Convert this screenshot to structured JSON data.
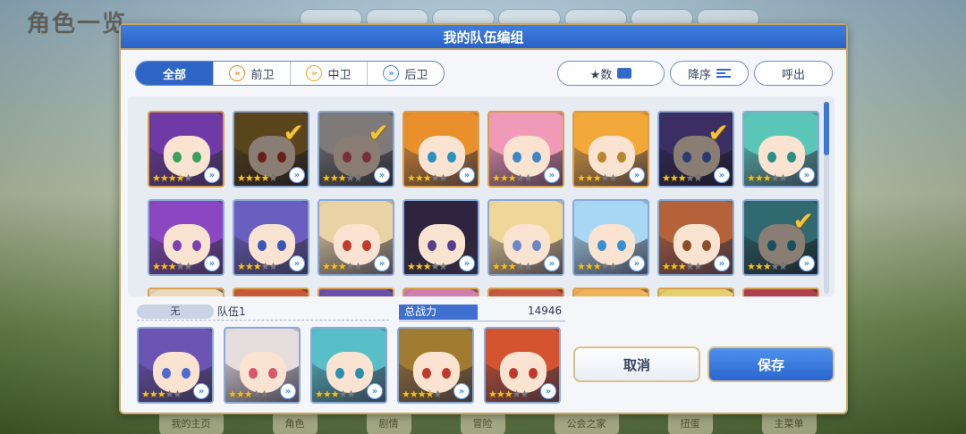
{
  "background": {
    "title": "角色一览",
    "bottom_nav": [
      "我的主页",
      "角色",
      "剧情",
      "冒险",
      "公会之家",
      "扭蛋",
      "主菜单"
    ]
  },
  "dialog": {
    "title": "我的队伍编组",
    "filters": [
      {
        "label": "全部",
        "icon": ""
      },
      {
        "label": "前卫",
        "icon": "front-role-icon"
      },
      {
        "label": "中卫",
        "icon": "middle-role-icon"
      },
      {
        "label": "后卫",
        "icon": "back-role-icon"
      }
    ],
    "star_button": "★数",
    "sort_button": "降序",
    "call_button": "呼出",
    "team": {
      "badge": "无",
      "name": "队伍1",
      "power_label": "总战力",
      "power_value": "14946"
    },
    "cancel_button": "取消",
    "save_button": "保存"
  },
  "colors": {
    "accent_blue": "#2f66c6",
    "gold_border": "#c9a662",
    "check": "#f2c43a"
  },
  "roster": [
    {
      "hair": "#6f3aa6",
      "eye": "#3aa05a",
      "stars": 4,
      "selected": false,
      "border": "gold"
    },
    {
      "hair": "#a27b32",
      "eye": "#c0392b",
      "stars": 4,
      "selected": true,
      "border": "blue"
    },
    {
      "hair": "#e6dede",
      "eye": "#d9556a",
      "stars": 3,
      "selected": true,
      "border": "blue"
    },
    {
      "hair": "#e98f2b",
      "eye": "#2c8fbf",
      "stars": 3,
      "selected": false,
      "border": "gold"
    },
    {
      "hair": "#f19ab8",
      "eye": "#3d86c7",
      "stars": 3,
      "selected": false,
      "border": "gold"
    },
    {
      "hair": "#f3a93a",
      "eye": "#b8862b",
      "stars": 3,
      "selected": false,
      "border": "gold"
    },
    {
      "hair": "#6c54b3",
      "eye": "#4f6bd0",
      "stars": 3,
      "selected": true,
      "border": "blue"
    },
    {
      "hair": "#5ac6b8",
      "eye": "#2a8f85",
      "stars": 3,
      "selected": false,
      "border": "blue"
    },
    {
      "hair": "#8a47c1",
      "eye": "#7b3fb0",
      "stars": 3,
      "selected": false,
      "border": "blue"
    },
    {
      "hair": "#6a5fc0",
      "eye": "#3a57b8",
      "stars": 3,
      "selected": false,
      "border": "blue"
    },
    {
      "hair": "#e9d3a4",
      "eye": "#c0392b",
      "stars": 3,
      "selected": false,
      "border": "blue"
    },
    {
      "hair": "#2f2440",
      "eye": "#5a3d8a",
      "stars": 3,
      "selected": false,
      "border": "blue"
    },
    {
      "hair": "#f1d69a",
      "eye": "#6a86c9",
      "stars": 3,
      "selected": false,
      "border": "blue"
    },
    {
      "hair": "#a9d8f4",
      "eye": "#3a8fd0",
      "stars": 3,
      "selected": false,
      "border": "blue"
    },
    {
      "hair": "#b5623a",
      "eye": "#8a4d2a",
      "stars": 3,
      "selected": false,
      "border": "blue"
    },
    {
      "hair": "#58bfc9",
      "eye": "#2b8fb0",
      "stars": 3,
      "selected": true,
      "border": "blue"
    }
  ],
  "roster_partial": [
    {
      "hair": "#e8d9bf"
    },
    {
      "hair": "#c85a3a"
    },
    {
      "hair": "#6c4fa8"
    },
    {
      "hair": "#d07fb0"
    },
    {
      "hair": "#c65a42"
    },
    {
      "hair": "#f0b35a"
    },
    {
      "hair": "#e5d070"
    },
    {
      "hair": "#b04050"
    }
  ],
  "team_members": [
    {
      "hair": "#6c54b3",
      "eye": "#4f6bd0",
      "stars": 3
    },
    {
      "hair": "#e6dede",
      "eye": "#d9556a",
      "stars": 3
    },
    {
      "hair": "#58bfc9",
      "eye": "#2b8fb0",
      "stars": 3
    },
    {
      "hair": "#a27b32",
      "eye": "#c0392b",
      "stars": 4
    },
    {
      "hair": "#d4542f",
      "eye": "#c0392b",
      "stars": 3
    }
  ]
}
